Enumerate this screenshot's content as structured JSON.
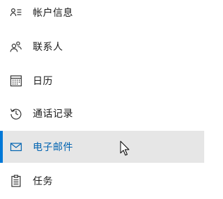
{
  "menu": {
    "items": [
      {
        "label": "帐户信息",
        "icon": "account-info-icon"
      },
      {
        "label": "联系人",
        "icon": "people-icon"
      },
      {
        "label": "日历",
        "icon": "calendar-icon"
      },
      {
        "label": "通话记录",
        "icon": "history-icon"
      },
      {
        "label": "电子邮件",
        "icon": "mail-icon",
        "selected": true
      },
      {
        "label": "任务",
        "icon": "clipboard-icon"
      }
    ]
  },
  "colors": {
    "accent": "#0078d7",
    "selected_text": "#0063b1",
    "selected_background": "#e6e6e6",
    "text": "#1a1a1a"
  }
}
